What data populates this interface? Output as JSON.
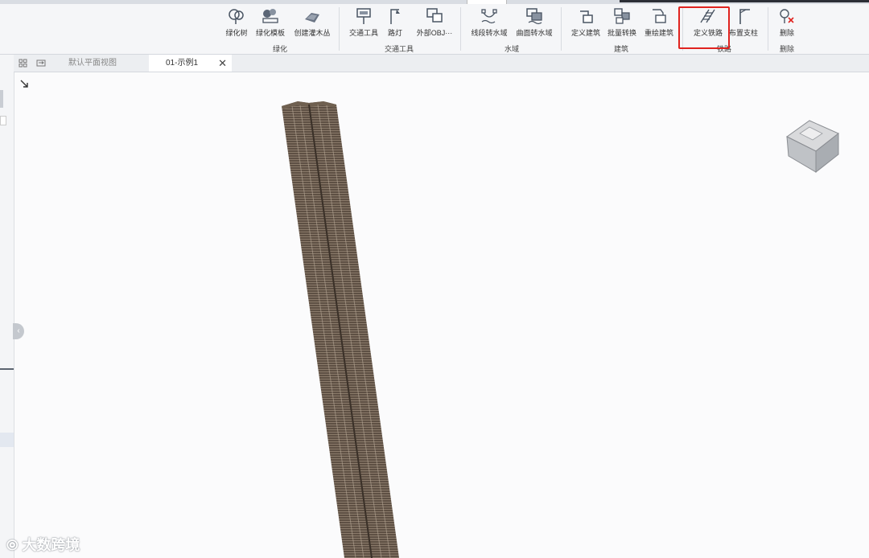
{
  "ribbon": {
    "groups": [
      {
        "title": "绿化",
        "tools": [
          {
            "label": "绿化树",
            "icon": "tree-icon"
          },
          {
            "label": "绿化模板",
            "icon": "greenery-template-icon"
          },
          {
            "label": "创建灌木丛",
            "icon": "shrub-icon"
          }
        ]
      },
      {
        "title": "交通工具",
        "tools": [
          {
            "label": "交通工具",
            "icon": "traffic-sign-icon"
          },
          {
            "label": "路灯",
            "icon": "street-lamp-icon"
          },
          {
            "label": "外部OBJ···",
            "icon": "external-obj-icon"
          }
        ]
      },
      {
        "title": "水域",
        "tools": [
          {
            "label": "线段转水域",
            "icon": "line-to-water-icon"
          },
          {
            "label": "曲面转水域",
            "icon": "surface-to-water-icon"
          }
        ]
      },
      {
        "title": "建筑",
        "tools": [
          {
            "label": "定义建筑",
            "icon": "define-building-icon"
          },
          {
            "label": "批量转换",
            "icon": "batch-convert-icon"
          },
          {
            "label": "重绘建筑",
            "icon": "redraw-building-icon"
          }
        ]
      },
      {
        "title": "铁路",
        "tools": [
          {
            "label": "定义铁路",
            "icon": "define-railway-icon"
          },
          {
            "label": "布置支柱",
            "icon": "place-pillar-icon"
          }
        ]
      },
      {
        "title": "删除",
        "tools": [
          {
            "label": "删除",
            "icon": "delete-icon"
          }
        ]
      }
    ]
  },
  "doc_tabs": [
    {
      "label": "默认平面视图",
      "active": false
    },
    {
      "label": "01-示例1",
      "active": true
    }
  ],
  "watermark": "大数跨境",
  "colors": {
    "highlight": "#e0231f",
    "rail": "#5e5044"
  }
}
